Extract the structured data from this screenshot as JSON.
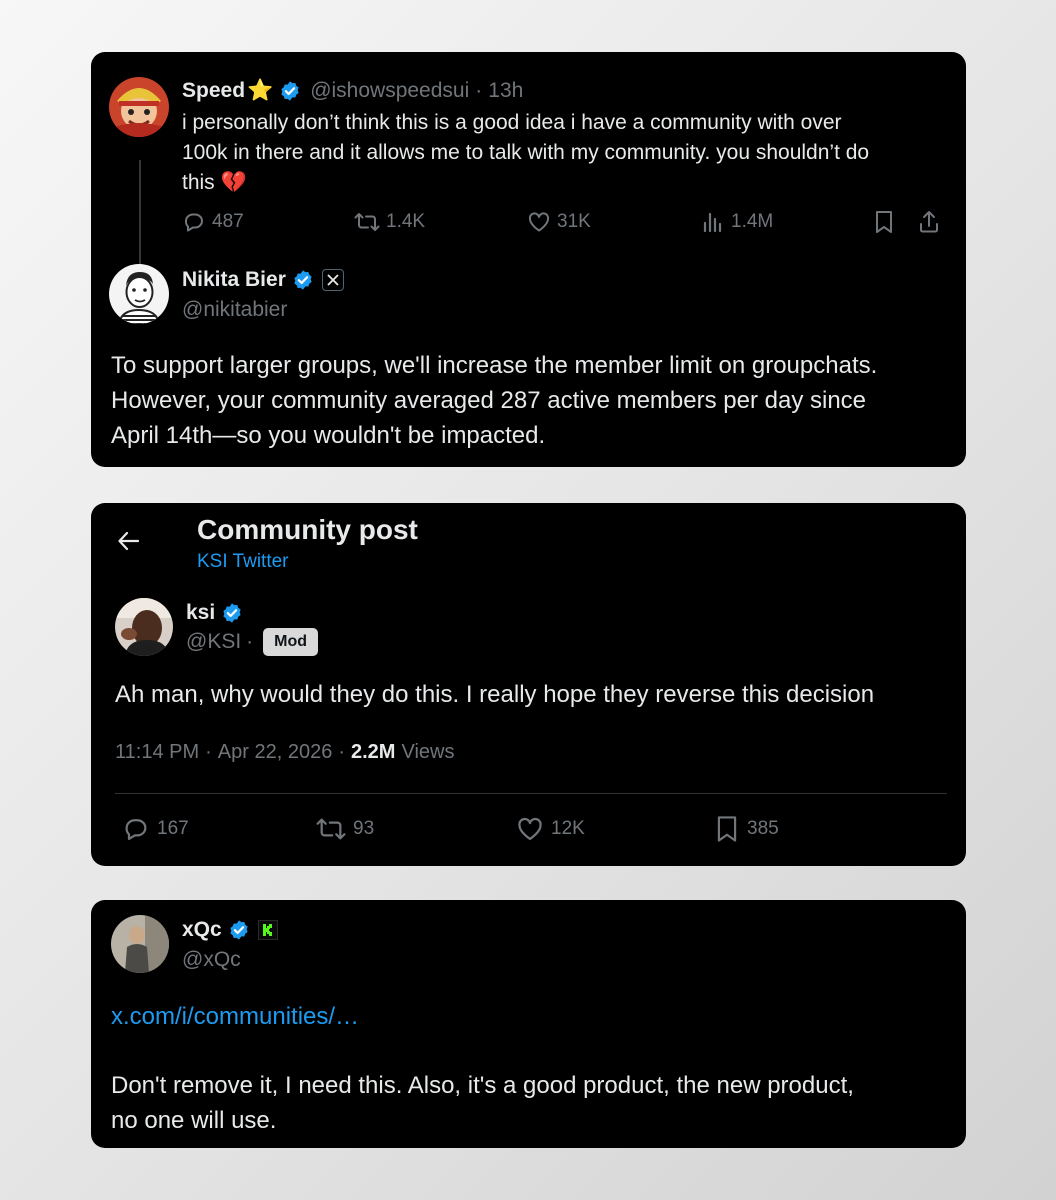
{
  "speed_tweet": {
    "name": "Speed",
    "name_emoji": "⭐",
    "handle": "@ishowspeedsui",
    "time": "13h",
    "text_line1": "i personally don’t think this is a good idea i have a community with over",
    "text_line2": "100k in there and it allows me to talk with my community. you shouldn’t do",
    "text_line3": "this",
    "text_emoji": "💔",
    "replies": "487",
    "retweets": "1.4K",
    "likes": "31K",
    "views": "1.4M"
  },
  "nikita_reply": {
    "name": "Nikita Bier",
    "handle": "@nikitabier",
    "text_line1": "To support larger groups, we'll increase the member limit on groupchats.",
    "text_line2": "However, your community averaged 287 active members per day since",
    "text_line3": "April 14th—so you wouldn't be impacted."
  },
  "community_post": {
    "header_title": "Community post",
    "community_name": "KSI Twitter",
    "name": "ksi",
    "handle": "@KSI",
    "separator": "·",
    "badge": "Mod",
    "text": "Ah man, why would they do this. I really hope they reverse this decision",
    "time": "11:14 PM",
    "date": "Apr 22, 2026",
    "views_count": "2.2M",
    "views_label": "Views",
    "replies": "167",
    "retweets": "93",
    "likes": "12K",
    "bookmarks": "385"
  },
  "xqc_tweet": {
    "name": "xQc",
    "handle": "@xQc",
    "link": "x.com/i/communities/…",
    "text_line1": "Don't remove it, I need this. Also, it's a good product, the new product,",
    "text_line2": "no one will use."
  },
  "colors": {
    "accent": "#1d9bf0",
    "card_bg": "#000000",
    "text": "#e7e9ea",
    "muted": "#71767b",
    "star": "#f5a623",
    "kick_green": "#53fc18"
  }
}
